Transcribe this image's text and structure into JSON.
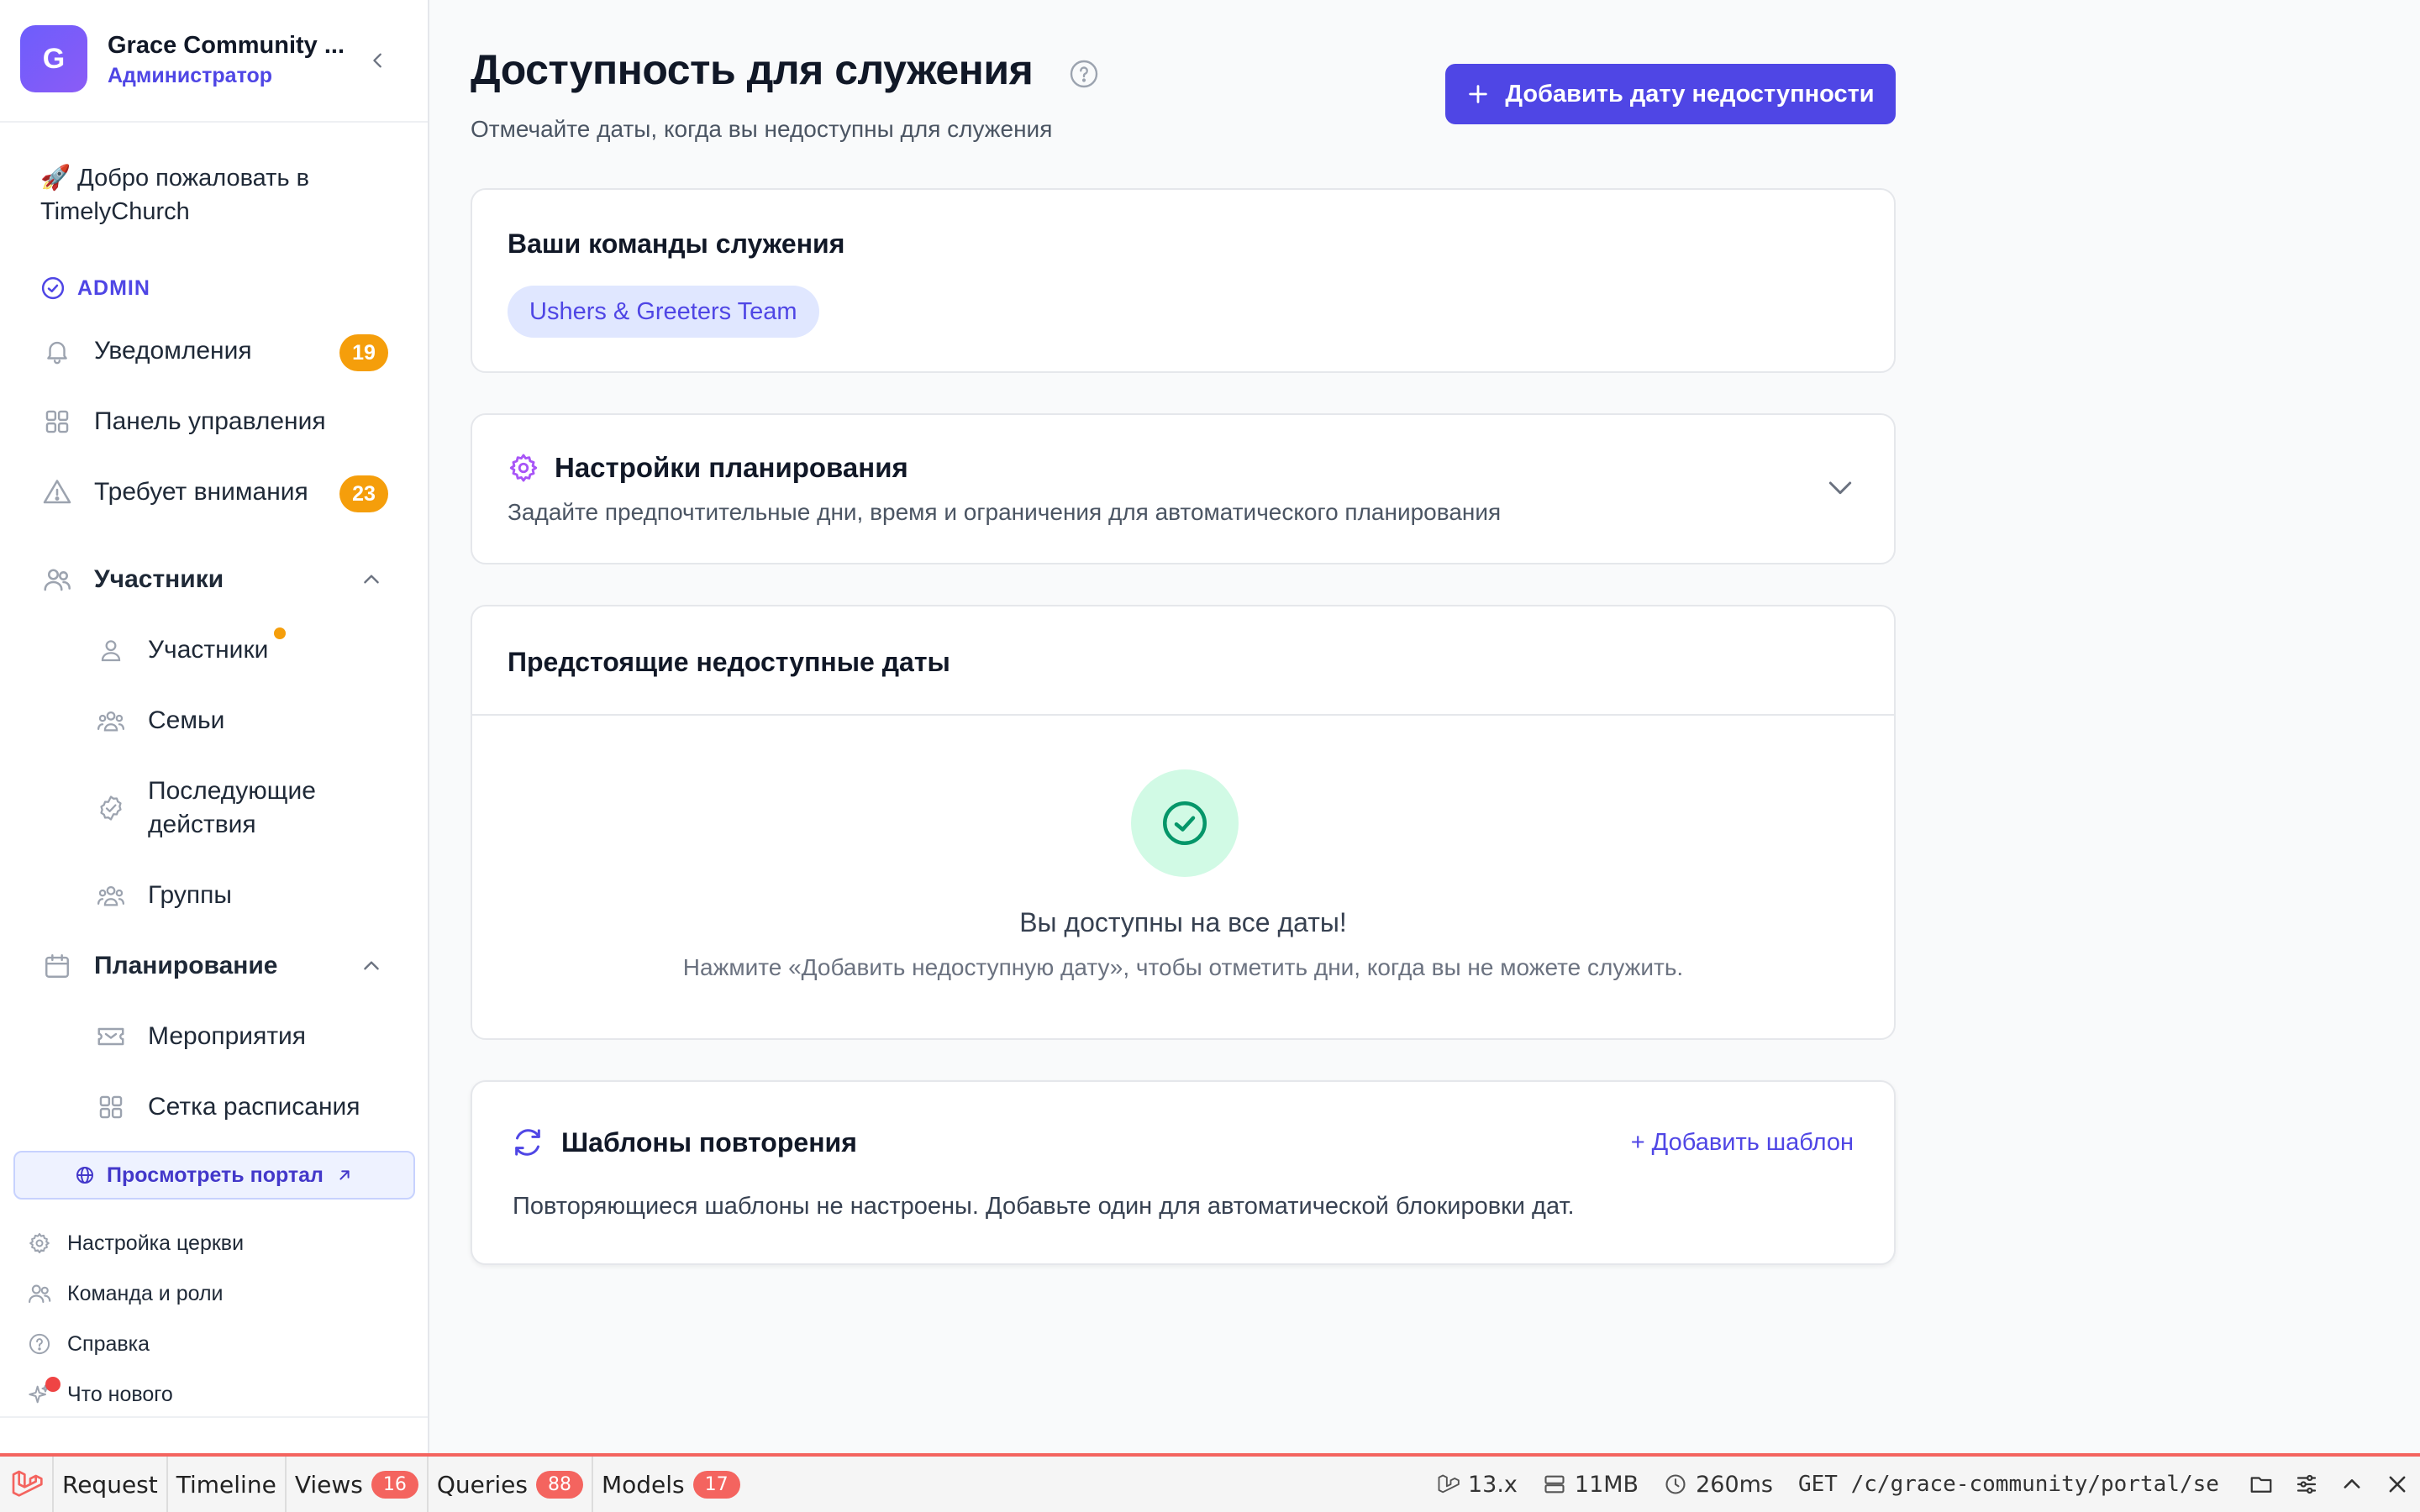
{
  "org": {
    "initial": "G",
    "name": "Grace Community ...",
    "role": "Администратор"
  },
  "sidebar": {
    "welcome": "🚀 Добро пожаловать в TimelyChurch",
    "section_label": "ADMIN",
    "items": [
      {
        "label": "Уведомления",
        "badge": "19",
        "icon": "bell-icon"
      },
      {
        "label": "Панель управления",
        "icon": "grid-icon"
      },
      {
        "label": "Требует внимания",
        "badge": "23",
        "icon": "warning-icon"
      }
    ],
    "groups": [
      {
        "label": "Участники",
        "icon": "users-icon",
        "children": [
          {
            "label": "Участники",
            "icon": "user-icon"
          },
          {
            "label": "Семьи",
            "icon": "family-icon"
          },
          {
            "label": "Последующие действия",
            "icon": "check-circle-icon"
          },
          {
            "label": "Группы",
            "icon": "group-icon"
          }
        ]
      },
      {
        "label": "Планирование",
        "icon": "calendar-icon",
        "children": [
          {
            "label": "Мероприятия",
            "icon": "ticket-icon"
          },
          {
            "label": "Сетка расписания",
            "icon": "grid-icon"
          }
        ]
      }
    ],
    "footer": {
      "portal_button": "Просмотреть портал",
      "links": [
        {
          "label": "Настройка церкви",
          "icon": "gear-icon"
        },
        {
          "label": "Команда и роли",
          "icon": "users-icon"
        },
        {
          "label": "Справка",
          "icon": "help-icon"
        },
        {
          "label": "Что нового",
          "icon": "sparkle-icon"
        }
      ]
    }
  },
  "page": {
    "title": "Доступность для служения",
    "subtitle": "Отмечайте даты, когда вы недоступны для служения",
    "primary_action": "Добавить дату недоступности"
  },
  "teams_card": {
    "title": "Ваши команды служения",
    "teams": [
      "Ushers & Greeters Team"
    ]
  },
  "settings_card": {
    "title": "Настройки планирования",
    "description": "Задайте предпочтительные дни, время и ограничения для автоматического планирования"
  },
  "upcoming_card": {
    "title": "Предстоящие недоступные даты",
    "empty_title": "Вы доступны на все даты!",
    "empty_description": "Нажмите «Добавить недоступную дату», чтобы отметить дни, когда вы не можете служить."
  },
  "recurring_card": {
    "title": "Шаблоны повторения",
    "add_link": "+ Добавить шаблон",
    "description": "Повторяющиеся шаблоны не настроены. Добавьте один для автоматической блокировки дат."
  },
  "debugbar": {
    "tabs": [
      {
        "label": "Request"
      },
      {
        "label": "Timeline"
      },
      {
        "label": "Views",
        "badge": "16"
      },
      {
        "label": "Queries",
        "badge": "88"
      },
      {
        "label": "Models",
        "badge": "17"
      }
    ],
    "version": "13.x",
    "memory": "11MB",
    "time": "260ms",
    "request": "GET /c/grace-community/portal/ser…"
  },
  "colors": {
    "accent": "#4f46e5",
    "badge": "#f59e0b",
    "success_bg": "#d1fae5",
    "success": "#059669",
    "debug_red": "#f4645f"
  }
}
